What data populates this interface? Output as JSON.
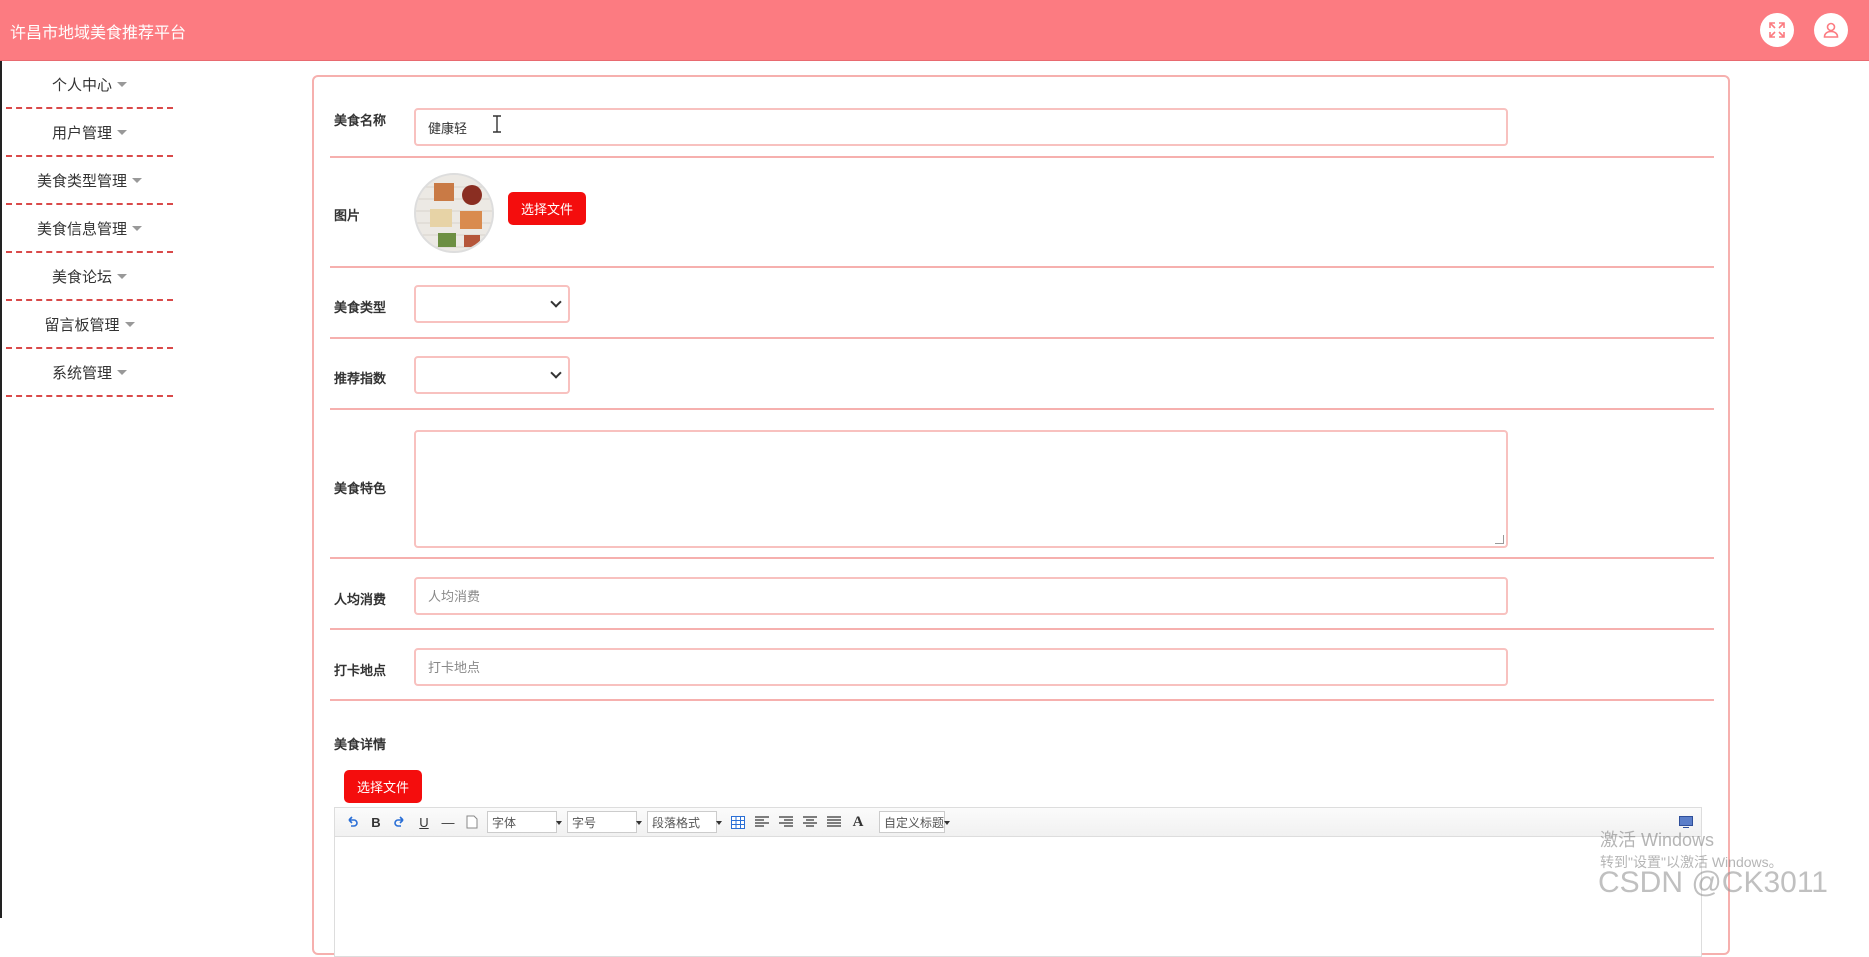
{
  "app": {
    "title": "许昌市地域美食推荐平台"
  },
  "header": {
    "icons": [
      "fullscreen-icon",
      "user-icon"
    ]
  },
  "sidebar": {
    "items": [
      {
        "label": "个人中心"
      },
      {
        "label": "用户管理"
      },
      {
        "label": "美食类型管理"
      },
      {
        "label": "美食信息管理"
      },
      {
        "label": "美食论坛"
      },
      {
        "label": "留言板管理"
      },
      {
        "label": "系统管理"
      }
    ]
  },
  "form": {
    "name": {
      "label": "美食名称",
      "value": "健康轻"
    },
    "image": {
      "label": "图片",
      "button": "选择文件"
    },
    "type": {
      "label": "美食类型",
      "value": ""
    },
    "rating": {
      "label": "推荐指数",
      "value": ""
    },
    "feature": {
      "label": "美食特色",
      "value": ""
    },
    "avg_cost": {
      "label": "人均消费",
      "placeholder": "人均消费"
    },
    "location": {
      "label": "打卡地点",
      "placeholder": "打卡地点"
    },
    "detail": {
      "label": "美食详情",
      "button": "选择文件",
      "toolbar": {
        "bold": "B",
        "underline": "U",
        "hr": "—",
        "font": "字体",
        "size": "字号",
        "paragraph": "段落格式",
        "color": "A",
        "custom_title": "自定义标题"
      }
    }
  },
  "watermark": {
    "line1": "激活 Windows",
    "line2": "转到\"设置\"以激活 Windows。",
    "csdn": "CSDN @CK3011"
  },
  "colors": {
    "header_bg": "#fc7b81",
    "accent_button": "#f40d0d",
    "border": "#f6b0ae",
    "sidebar_divider": "#d94949"
  }
}
